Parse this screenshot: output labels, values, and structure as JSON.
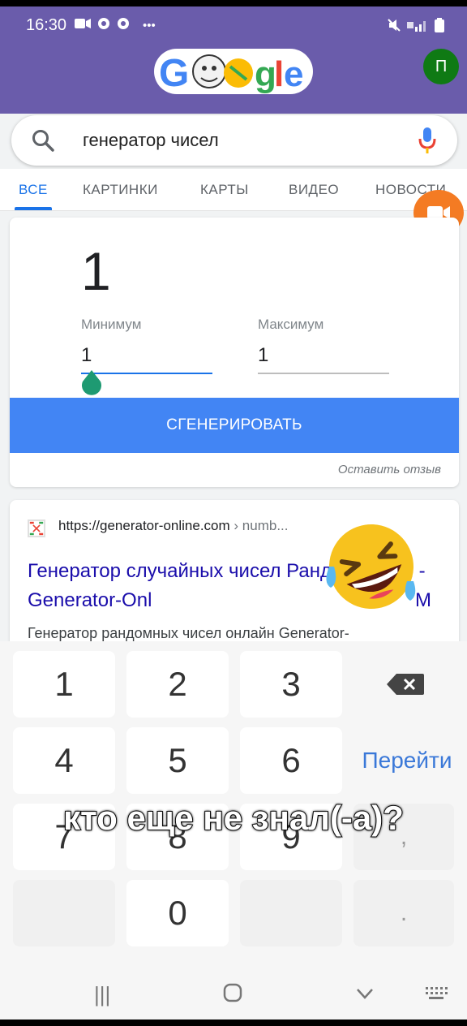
{
  "status_bar": {
    "time": "16:30",
    "left_icons": [
      "video-icon",
      "chrome-icon",
      "chrome-icon",
      "more-icon"
    ],
    "right_icons": [
      "mute-icon",
      "signal-4g-icon",
      "battery-icon"
    ]
  },
  "header": {
    "logo_text": "Google",
    "avatar_letter": "П",
    "accent_color": "#6a5cab"
  },
  "search": {
    "query": "генератор чисел"
  },
  "tabs": [
    {
      "label": "ВСЕ",
      "active": true
    },
    {
      "label": "КАРТИНКИ",
      "active": false
    },
    {
      "label": "КАРТЫ",
      "active": false
    },
    {
      "label": "ВИДЕО",
      "active": false
    },
    {
      "label": "НОВОСТИ",
      "active": false
    }
  ],
  "generator": {
    "result": "1",
    "min_label": "Минимум",
    "min_value": "1",
    "max_label": "Максимум",
    "max_value": "1",
    "button_label": "СГЕНЕРИРОВАТЬ",
    "feedback_label": "Оставить отзыв",
    "button_color": "#4285f4"
  },
  "result": {
    "url": "https://generator-online.com",
    "breadcrumb": "› numb...",
    "title": "Генератор случайных чисел Рандом чисел - Generator-Onl",
    "title_tail": "M",
    "snippet": "Генератор рандомных чисел онлайн Generator-"
  },
  "keyboard": {
    "keys": [
      "1",
      "2",
      "3",
      "4",
      "5",
      "6",
      "7",
      "8",
      "9",
      "0"
    ],
    "go_label": "Перейти",
    "comma": ",",
    "period": "."
  },
  "overlay_caption": "кто еще не знал(-а)?",
  "nav": {
    "recent": "|||",
    "home": "○",
    "back": "∨",
    "keyboard": "⌨"
  }
}
